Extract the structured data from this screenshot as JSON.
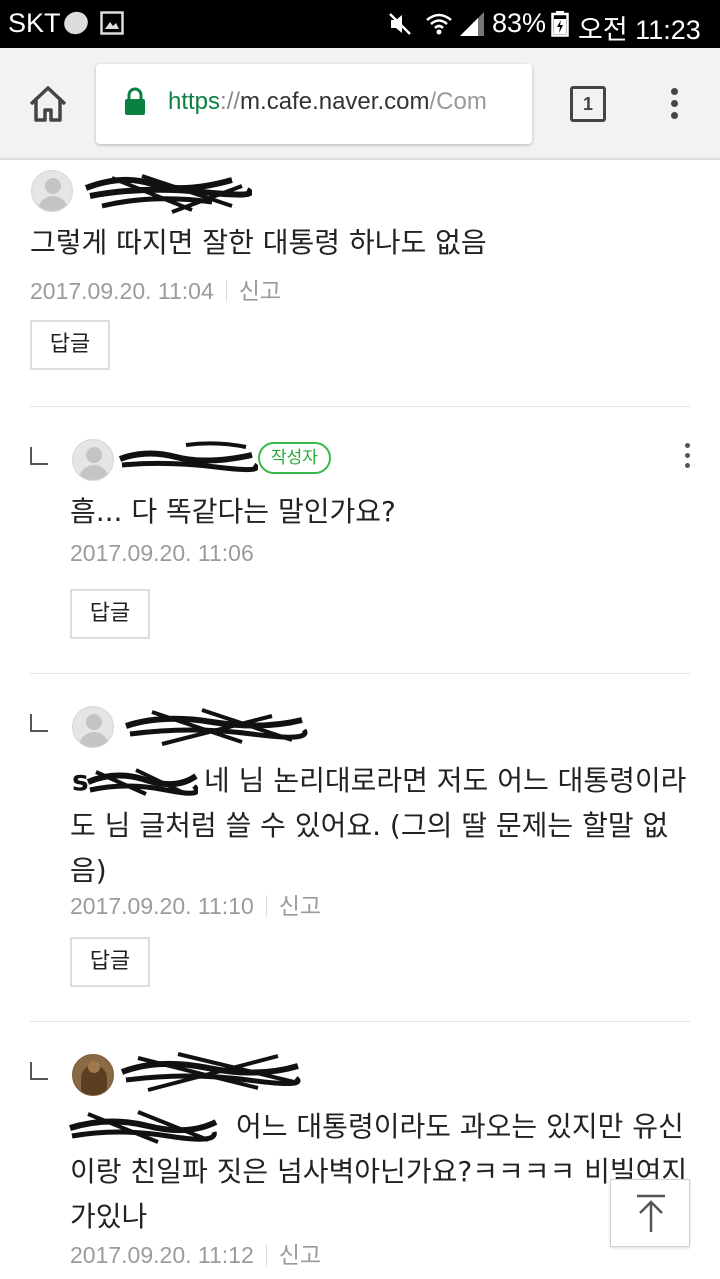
{
  "status_bar": {
    "carrier": "SKT",
    "battery": "83%",
    "time": "오전 11:23"
  },
  "browser": {
    "url_scheme": "https",
    "url_separator": "://",
    "url_host": "m.cafe.naver.com",
    "url_rest": "/Com",
    "tab_count": "1"
  },
  "comments": [
    {
      "text": "그렇게 따지면 잘한 대통령 하나도 없음",
      "date": "2017.09.20. 11:04",
      "report": "신고",
      "reply_label": "답글"
    },
    {
      "badge": "작성자",
      "text": "흠... 다 똑같다는 말인가요?",
      "date": "2017.09.20. 11:06",
      "reply_label": "답글"
    },
    {
      "mention_partial": "s",
      "text": "네 님 논리대로라면 저도 어느 대통령이라도 님 글처럼 쓸 수 있어요. (그의 딸 문제는 할말 없음)",
      "date": "2017.09.20. 11:10",
      "report": "신고",
      "reply_label": "답글"
    },
    {
      "text": "어느 대통령이라도 과오는 있지만 유신이랑 친일파 짓은 넘사벽아닌가요?ㅋㅋㅋㅋ 비빌여지가있나",
      "date": "2017.09.20. 11:12",
      "report": "신고"
    }
  ],
  "icons": {
    "home": "home-icon",
    "lock": "lock-icon",
    "menu": "more-vert-icon",
    "scroll_top": "arrow-up-icon"
  },
  "colors": {
    "url_green": "#0b8043",
    "badge_green": "#3cb84a",
    "status_bar": "#000000",
    "browser_bar": "#f2f2f2"
  }
}
